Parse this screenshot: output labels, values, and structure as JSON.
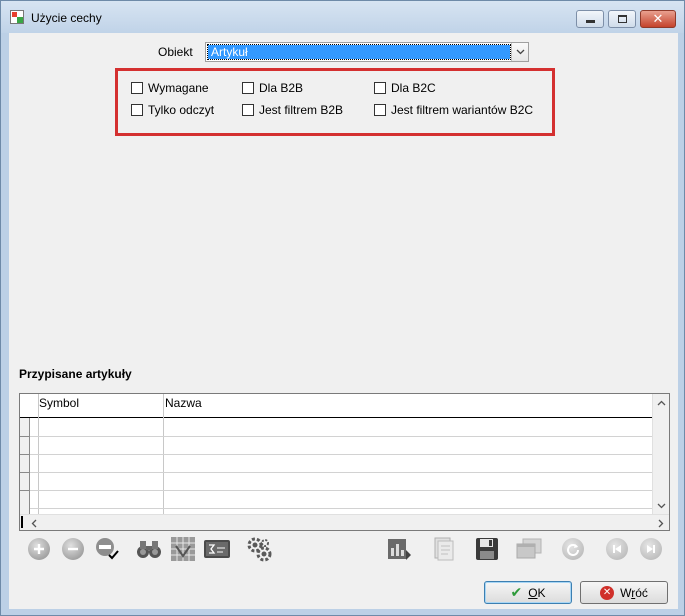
{
  "window": {
    "title": "Użycie cechy",
    "minimize_glyph": "",
    "close_glyph": "✕"
  },
  "form": {
    "obiekt_label": "Obiekt",
    "obiekt_value": "Artykuł",
    "checkboxes": {
      "wymagane": "Wymagane",
      "dla_b2b": "Dla B2B",
      "dla_b2c": "Dla B2C",
      "tylko_odczyt": "Tylko odczyt",
      "jest_filtrem_b2b": "Jest filtrem B2B",
      "jest_filtrem_wariantow_b2c": "Jest filtrem wariantów B2C"
    }
  },
  "section": {
    "title": "Przypisane artykuły"
  },
  "grid": {
    "columns": [
      "Symbol",
      "Nazwa"
    ],
    "rows": []
  },
  "toolbar": {
    "icons": [
      "add-icon",
      "remove-icon",
      "edit-confirm-icon",
      "binoculars-icon",
      "grid-view-icon",
      "formula-icon",
      "gears-icon",
      "report-icon",
      "export-icon",
      "save-icon",
      "windows-icon",
      "refresh-icon",
      "first-icon",
      "last-icon"
    ]
  },
  "footer": {
    "ok_hotkey": "O",
    "ok_rest": "K",
    "back_pre": "W",
    "back_hotkey": "r",
    "back_rest": "óć"
  },
  "colors": {
    "selection": "#3399ff",
    "highlight_box": "#d43030",
    "ok_check": "#2e9a3a",
    "cancel_x": "#d0302a"
  }
}
